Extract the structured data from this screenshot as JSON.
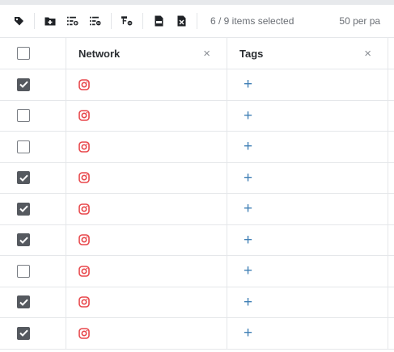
{
  "toolbar": {
    "icons": [
      "tag-icon",
      "folder-add-icon",
      "list-add-icon",
      "list-remove-icon",
      "hierarchy-remove-icon",
      "export-csv-icon",
      "export-excel-icon"
    ],
    "selection_text": "6 / 9 items selected",
    "per_page_text": "50 per pa"
  },
  "columns": {
    "network": "Network",
    "tags": "Tags",
    "close_glyph": "×"
  },
  "rows": [
    {
      "checked": true,
      "network": "instagram-icon",
      "tag_add": "+"
    },
    {
      "checked": false,
      "network": "instagram-icon",
      "tag_add": "+"
    },
    {
      "checked": false,
      "network": "instagram-icon",
      "tag_add": "+"
    },
    {
      "checked": true,
      "network": "instagram-icon",
      "tag_add": "+"
    },
    {
      "checked": true,
      "network": "instagram-icon",
      "tag_add": "+"
    },
    {
      "checked": true,
      "network": "instagram-icon",
      "tag_add": "+"
    },
    {
      "checked": false,
      "network": "instagram-icon",
      "tag_add": "+"
    },
    {
      "checked": true,
      "network": "instagram-icon",
      "tag_add": "+"
    },
    {
      "checked": true,
      "network": "instagram-icon",
      "tag_add": "+"
    }
  ],
  "colors": {
    "instagram": "#e8474b",
    "plus": "#3f7fb5",
    "checkbox_checked": "#55595f"
  }
}
